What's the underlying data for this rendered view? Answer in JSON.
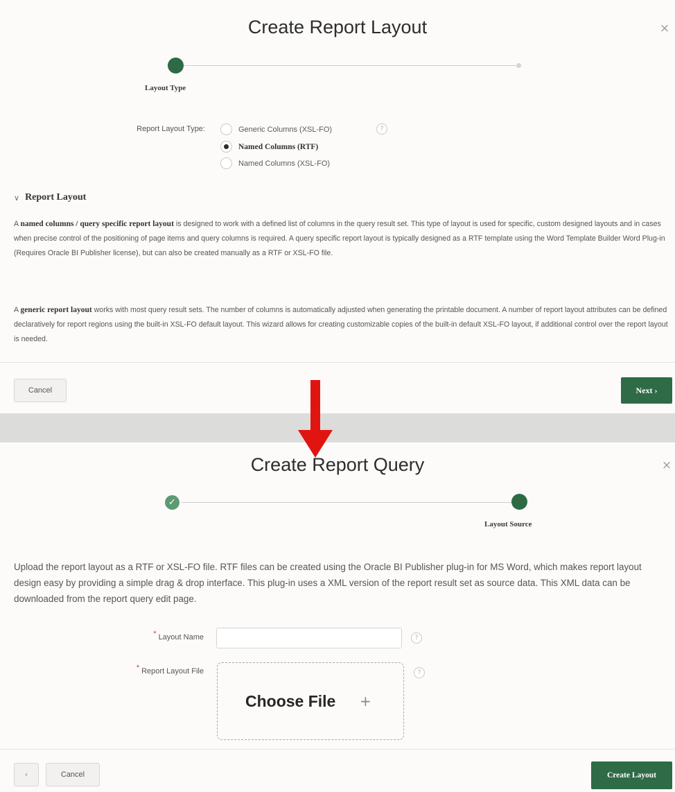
{
  "top_dialog": {
    "title": "Create Report Layout",
    "close_glyph": "×",
    "step_label": "Layout Type",
    "form_label": "Report Layout Type:",
    "radio_options": [
      {
        "label": "Generic Columns (XSL-FO)",
        "checked": false
      },
      {
        "label": "Named Columns (RTF)",
        "checked": true
      },
      {
        "label": "Named Columns (XSL-FO)",
        "checked": false
      }
    ],
    "help_glyph": "?",
    "section_title": "Report Layout",
    "section_chevron": "∨",
    "para1_bold": "named columns / query specific report layout",
    "para1_lead": "A ",
    "para1_rest": " is designed to work with a defined list of columns in the query result set. This type of layout is used for specific, custom designed layouts and in cases when precise control of the positioning of page items and query columns is required. A query specific report layout is typically designed as a RTF template using the Word Template Builder Word Plug-in (Requires Oracle BI Publisher license), but can also be created manually as a RTF or XSL-FO file.",
    "para2_lead": "A ",
    "para2_bold": "generic report layout",
    "para2_rest": " works with most query result sets. The number of columns is automatically adjusted when generating the printable document. A number of report layout attributes can be defined declaratively for report regions using the built-in XSL-FO default layout. This wizard allows for creating customizable copies of the built-in default XSL-FO layout, if additional control over the report layout is needed.",
    "cancel_label": "Cancel",
    "next_label": "Next ›"
  },
  "bottom_dialog": {
    "title": "Create Report Query",
    "close_glyph": "×",
    "done_glyph": "✓",
    "step_label": "Layout Source",
    "intro": "Upload the report layout as a RTF or XSL-FO file. RTF files can be created using the Oracle BI Publisher plug-in for MS Word, which makes report layout design easy by providing a simple drag & drop interface. This plug-in uses a XML version of the report result set as source data. This XML data can be downloaded from the report query edit page.",
    "required_mark": "*",
    "layout_name_label": "Layout Name",
    "layout_name_value": "",
    "report_layout_file_label": "Report Layout File",
    "choose_file_label": "Choose File",
    "plus_glyph": "+",
    "help_glyph": "?",
    "prev_glyph": "‹",
    "cancel_label": "Cancel",
    "create_label": "Create Layout"
  },
  "colors": {
    "accent_green": "#2f6b46",
    "arrow_red": "#e01512",
    "done_step_green": "#5d9a72"
  },
  "icons": {
    "close": "close-icon",
    "help": "help-icon",
    "chevron": "chevron-down-icon",
    "check": "check-icon",
    "plus": "plus-icon",
    "prev": "chevron-left-icon",
    "arrow": "down-arrow-icon"
  }
}
